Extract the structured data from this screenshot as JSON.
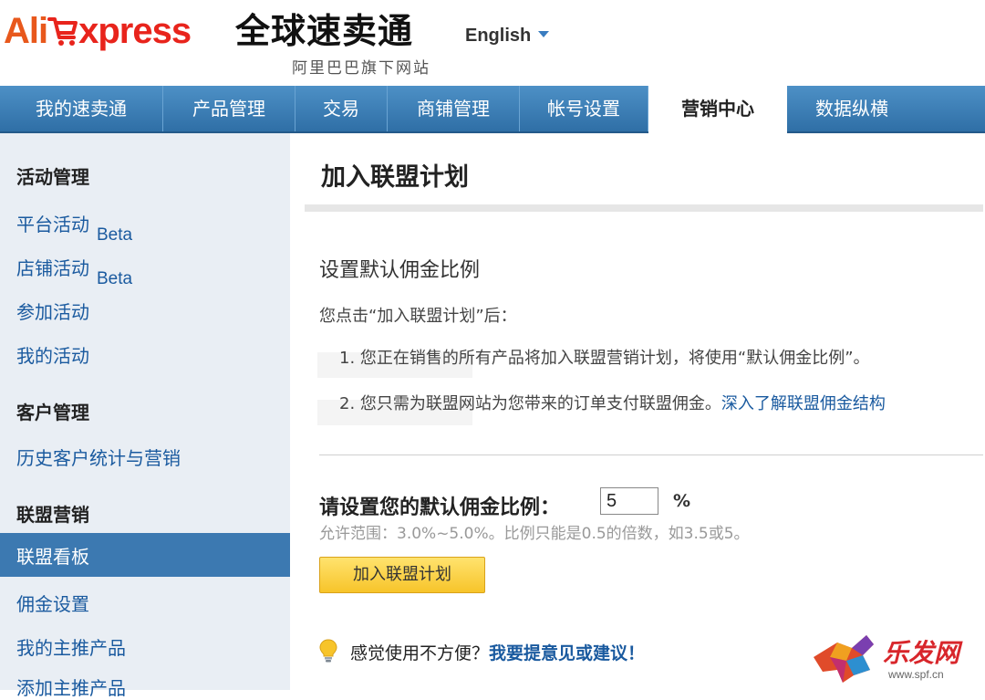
{
  "header": {
    "brand_ali": "Ali",
    "brand_xpress": "xpress",
    "brand_cn": "全球速卖通",
    "brand_sub": "阿里巴巴旗下网站",
    "language": "English",
    "brand_color": "#e8241c"
  },
  "nav": {
    "items": [
      "我的速卖通",
      "产品管理",
      "交易",
      "商铺管理",
      "帐号设置",
      "营销中心",
      "数据纵横"
    ],
    "active": "营销中心"
  },
  "sidebar": {
    "group1": "活动管理",
    "platform_activity": "平台活动",
    "store_activity": "店铺活动",
    "beta": "Beta",
    "join_activity": "参加活动",
    "my_activity": "我的活动",
    "group2": "客户管理",
    "history_customers": "历史客户统计与营销",
    "group3": "联盟营销",
    "affiliate_dashboard": "联盟看板",
    "commission_settings": "佣金设置",
    "my_featured": "我的主推产品",
    "add_featured": "添加主推产品"
  },
  "main": {
    "page_title": "加入联盟计划",
    "section_title": "设置默认佣金比例",
    "intro": "您点击“加入联盟计划”后：",
    "item1": "1. 您正在销售的所有产品将加入联盟营销计划，将使用“默认佣金比例”。",
    "item2": "2. 您只需为联盟网站为您带来的订单支付联盟佣金。",
    "item2_link": "深入了解联盟佣金结构",
    "rate_label": "请设置您的默认佣金比例：",
    "rate_value": "5",
    "rate_unit": "%",
    "hint": "允许范围：3.0%~5.0%。比例只能是0.5的倍数，如3.5或5。",
    "join_button": "加入联盟计划",
    "feedback_text": "感觉使用不方便？",
    "feedback_link": "我要提意见或建议！"
  },
  "watermark": {
    "cn": "乐发网",
    "url": "www.spf.cn"
  }
}
